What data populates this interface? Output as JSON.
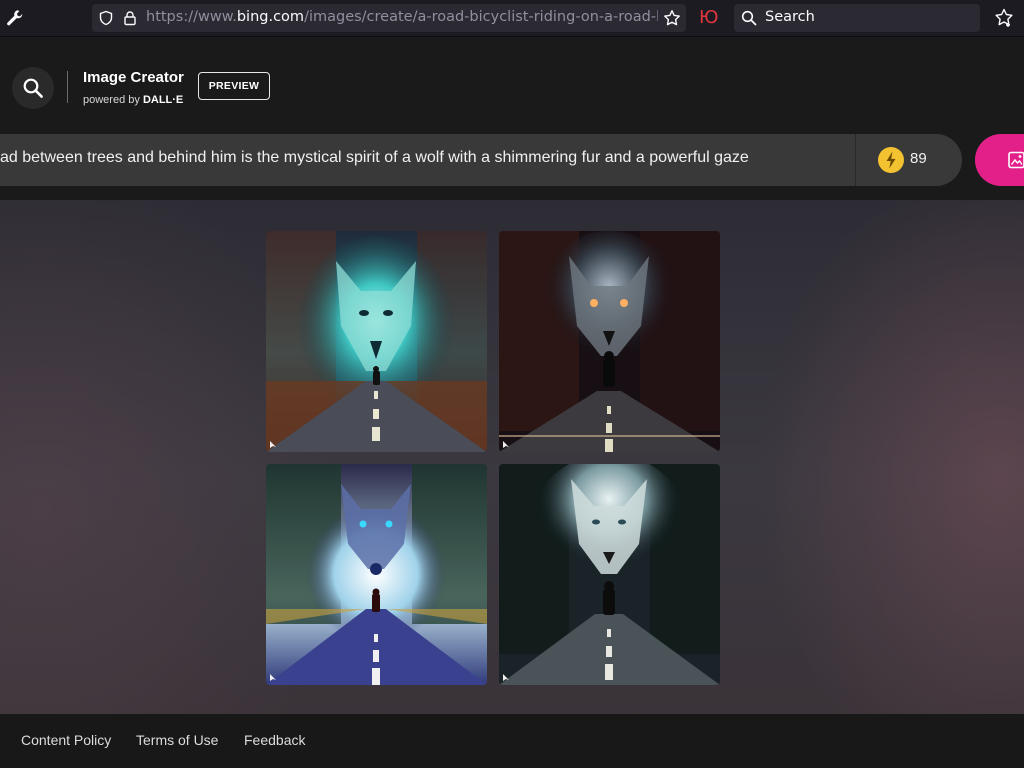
{
  "browser": {
    "url_prefix": "https://www.",
    "url_host": "bing.com",
    "url_path": "/images/create/a-road-bicyclist-riding-on-a-road-be",
    "extension_glyph": "Ю",
    "search_placeholder": "Search"
  },
  "header": {
    "title": "Image Creator",
    "powered_prefix": "powered by ",
    "powered_brand": "DALL·E",
    "preview_label": "PREVIEW"
  },
  "prompt": {
    "text": "ad between trees and behind him is the mystical spirit of a wolf with a shimmering fur and a powerful gaze",
    "boosts": "89"
  },
  "images": [
    {
      "name": "generated-image-1"
    },
    {
      "name": "generated-image-2"
    },
    {
      "name": "generated-image-3"
    },
    {
      "name": "generated-image-4"
    }
  ],
  "footer": {
    "links": [
      "Content Policy",
      "Terms of Use",
      "Feedback"
    ]
  },
  "colors": {
    "accent": "#e3208a",
    "boost": "#f2c230",
    "header_bg": "#1b1a1a",
    "footer_bg": "#181818"
  },
  "icons": [
    "wrench-icon",
    "shield-icon",
    "lock-icon",
    "star-icon",
    "search-icon",
    "bookmark-star-icon",
    "lightning-icon",
    "image-create-icon"
  ]
}
